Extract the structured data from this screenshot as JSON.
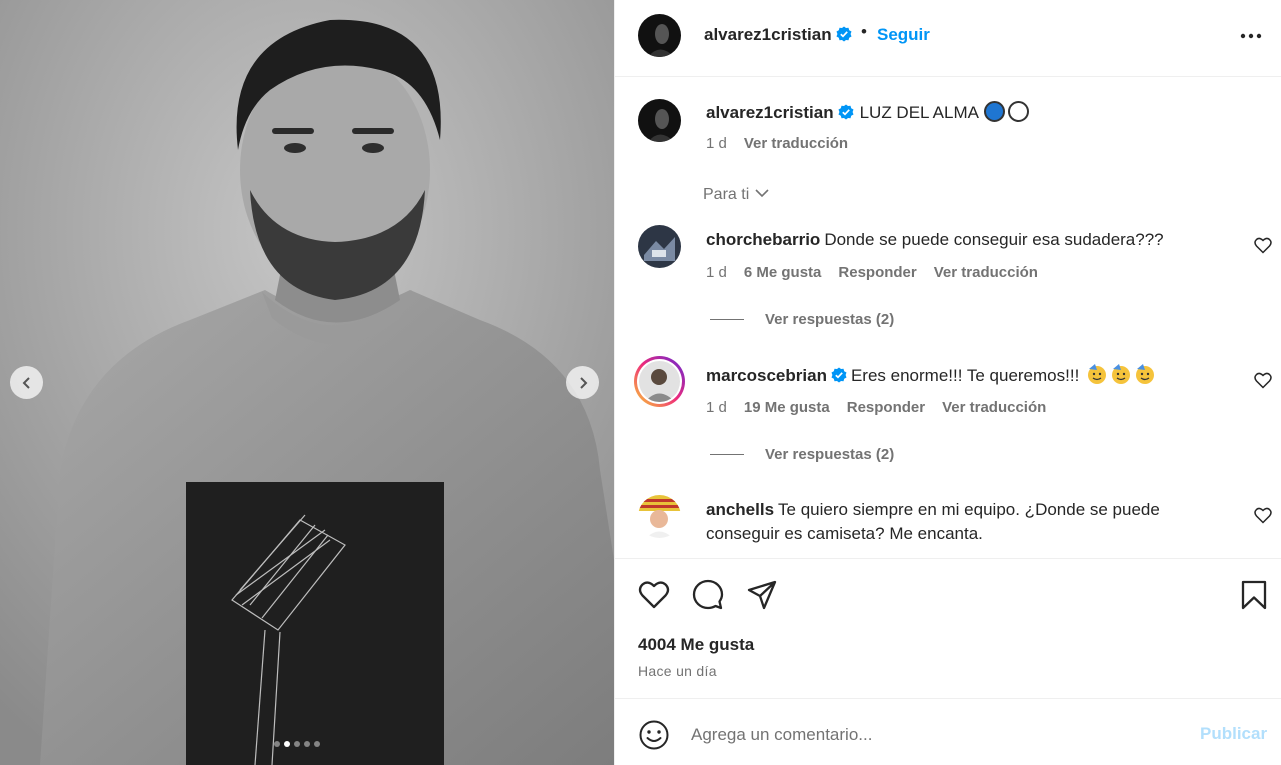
{
  "post": {
    "username": "alvarez1cristian",
    "follow_label": "Seguir",
    "separator": "•",
    "caption": "LUZ DEL ALMA",
    "caption_time": "1 d",
    "translate_label": "Ver traducción",
    "likes_text": "4004 Me gusta",
    "posted_ago": "Hace un día"
  },
  "media": {
    "carousel_total": 5,
    "carousel_active": 2
  },
  "comments_filter": "Para ti",
  "comments": [
    {
      "username": "chorchebarrio",
      "verified": false,
      "text": "Donde se puede conseguir esa sudadera???",
      "time": "1 d",
      "likes": "6 Me gusta",
      "reply_label": "Responder",
      "translate_label": "Ver traducción",
      "view_replies": "Ver respuestas (2)"
    },
    {
      "username": "marcoscebrian",
      "verified": true,
      "text": "Eres enorme!!! Te queremos!!!",
      "time": "1 d",
      "likes": "19 Me gusta",
      "reply_label": "Responder",
      "translate_label": "Ver traducción",
      "view_replies": "Ver respuestas (2)"
    },
    {
      "username": "anchells",
      "verified": false,
      "text": "Te quiero siempre en mi equipo. ¿Donde se puede conseguir es camiseta? Me encanta."
    }
  ],
  "add_comment": {
    "placeholder": "Agrega un comentario...",
    "publish_label": "Publicar"
  },
  "colors": {
    "accent": "#0095f6",
    "publish_disabled": "#b2dffc",
    "muted": "#737373",
    "text": "#262626"
  },
  "icons": {
    "like": "heart-icon",
    "comment": "comment-bubble-icon",
    "share": "paper-plane-icon",
    "save": "bookmark-icon",
    "emoji": "smiley-icon",
    "more": "more-options-icon"
  }
}
